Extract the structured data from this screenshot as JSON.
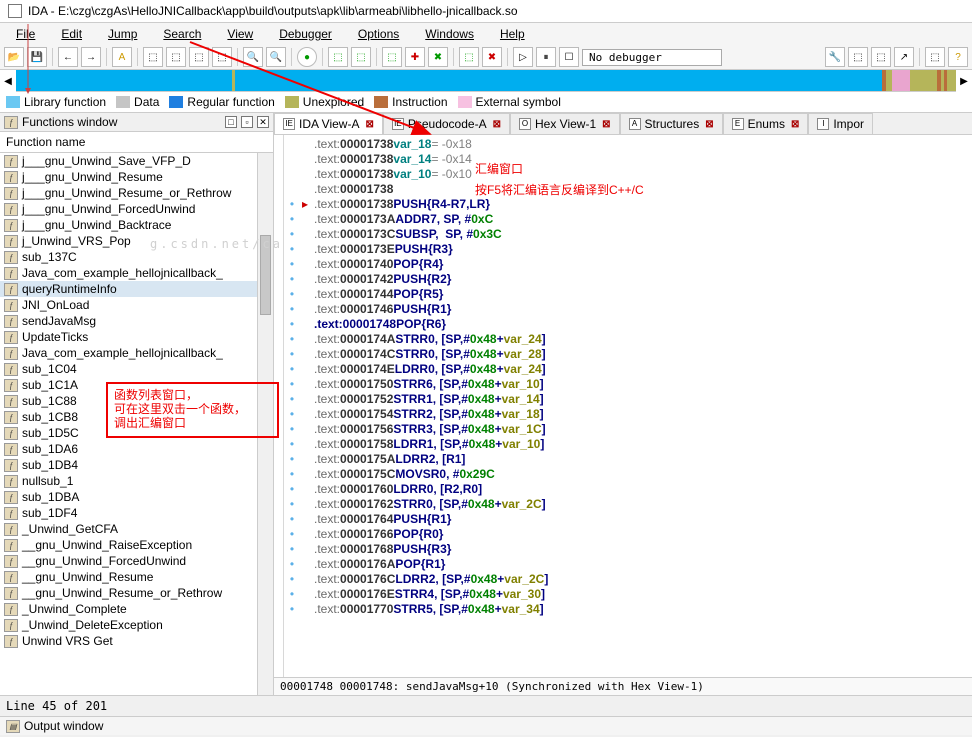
{
  "title": "IDA - E:\\czg\\czgAs\\HelloJNICallback\\app\\build\\outputs\\apk\\lib\\armeabi\\libhello-jnicallback.so",
  "menu": [
    "File",
    "Edit",
    "Jump",
    "Search",
    "View",
    "Debugger",
    "Options",
    "Windows",
    "Help"
  ],
  "debugger_sel": "No debugger",
  "legend": [
    {
      "color": "#6bc8f2",
      "label": "Library function"
    },
    {
      "color": "#c5c5c5",
      "label": "Data"
    },
    {
      "color": "#1f7fe0",
      "label": "Regular function"
    },
    {
      "color": "#b5b55a",
      "label": "Unexplored"
    },
    {
      "color": "#b96e3b",
      "label": "Instruction"
    },
    {
      "color": "#f7c1e1",
      "label": "External symbol"
    }
  ],
  "functions_panel": {
    "title": "Functions window",
    "header": "Function name",
    "items": [
      "j___gnu_Unwind_Save_VFP_D",
      "j___gnu_Unwind_Resume",
      "j___gnu_Unwind_Resume_or_Rethrow",
      "j___gnu_Unwind_ForcedUnwind",
      "j___gnu_Unwind_Backtrace",
      "j_Unwind_VRS_Pop",
      "sub_137C",
      "Java_com_example_hellojnicallback_",
      "queryRuntimeInfo",
      "JNI_OnLoad",
      "sendJavaMsg",
      "UpdateTicks",
      "Java_com_example_hellojnicallback_",
      "sub_1C04",
      "sub_1C1A",
      "sub_1C88",
      "sub_1CB8",
      "sub_1D5C",
      "sub_1DA6",
      "sub_1DB4",
      "nullsub_1",
      "sub_1DBA",
      "sub_1DF4",
      "_Unwind_GetCFA",
      "__gnu_Unwind_RaiseException",
      "__gnu_Unwind_ForcedUnwind",
      "__gnu_Unwind_Resume",
      "__gnu_Unwind_Resume_or_Rethrow",
      "_Unwind_Complete",
      "_Unwind_DeleteException",
      "Unwind VRS Get"
    ],
    "selected_index": 8
  },
  "tabs": [
    {
      "icon": "IE",
      "label": "IDA View-A",
      "active": true,
      "close": true
    },
    {
      "icon": "IE",
      "label": "Pseudocode-A",
      "close": true
    },
    {
      "icon": "O",
      "label": "Hex View-1",
      "close": true
    },
    {
      "icon": "A",
      "label": "Structures",
      "close": true
    },
    {
      "icon": "E",
      "label": "Enums",
      "close": true
    },
    {
      "icon": "I",
      "label": "Impor",
      "close": false
    }
  ],
  "disasm": [
    {
      "b": "",
      "addr": ".text:00001738",
      "lbl": "var_18",
      "eq": "= -0x18"
    },
    {
      "b": "",
      "addr": ".text:00001738",
      "lbl": "var_14",
      "eq": "= -0x14"
    },
    {
      "b": "",
      "addr": ".text:00001738",
      "lbl": "var_10",
      "eq": "= -0x10"
    },
    {
      "b": "",
      "addr": ".text:00001738"
    },
    {
      "b": "•",
      "mark": "▸",
      "addr": ".text:00001738",
      "mn": "PUSH",
      "ops": "{R4-R7,LR}"
    },
    {
      "b": "•",
      "addr": ".text:0000173A",
      "mn": "ADD",
      "ops": "R7, SP, #0xC",
      "hl": "0xC"
    },
    {
      "b": "•",
      "addr": ".text:0000173C",
      "mn": "SUB",
      "ops": "SP,  SP, #0x3C",
      "hl": "0x3C"
    },
    {
      "b": "•",
      "addr": ".text:0000173E",
      "mn": "PUSH",
      "ops": "{R3}"
    },
    {
      "b": "•",
      "addr": ".text:00001740",
      "mn": "POP",
      "ops": "{R4}"
    },
    {
      "b": "•",
      "addr": ".text:00001742",
      "mn": "PUSH",
      "ops": "{R2}"
    },
    {
      "b": "•",
      "addr": ".text:00001744",
      "mn": "POP",
      "ops": "{R5}"
    },
    {
      "b": "•",
      "addr": ".text:00001746",
      "mn": "PUSH",
      "ops": "{R1}"
    },
    {
      "b": "•",
      "addr": ".text:00001748",
      "bold": true,
      "mn": "POP",
      "ops": "{R6}"
    },
    {
      "b": "•",
      "addr": ".text:0000174A",
      "mn": "STR",
      "ops": "R0, [SP,#0x48+var_24]",
      "vr": "var_24"
    },
    {
      "b": "•",
      "addr": ".text:0000174C",
      "mn": "STR",
      "ops": "R0, [SP,#0x48+var_28]",
      "vr": "var_28"
    },
    {
      "b": "•",
      "addr": ".text:0000174E",
      "mn": "LDR",
      "ops": "R0, [SP,#0x48+var_24]",
      "vr": "var_24"
    },
    {
      "b": "•",
      "addr": ".text:00001750",
      "mn": "STR",
      "ops": "R6, [SP,#0x48+var_10]",
      "vr": "var_10"
    },
    {
      "b": "•",
      "addr": ".text:00001752",
      "mn": "STR",
      "ops": "R1, [SP,#0x48+var_14]",
      "vr": "var_14"
    },
    {
      "b": "•",
      "addr": ".text:00001754",
      "mn": "STR",
      "ops": "R2, [SP,#0x48+var_18]",
      "vr": "var_18"
    },
    {
      "b": "•",
      "addr": ".text:00001756",
      "mn": "STR",
      "ops": "R3, [SP,#0x48+var_1C]",
      "vr": "var_1C"
    },
    {
      "b": "•",
      "addr": ".text:00001758",
      "mn": "LDR",
      "ops": "R1, [SP,#0x48+var_10]",
      "vr": "var_10"
    },
    {
      "b": "•",
      "addr": ".text:0000175A",
      "mn": "LDR",
      "ops": "R2, [R1]"
    },
    {
      "b": "•",
      "addr": ".text:0000175C",
      "mn": "MOVS",
      "ops": "R0, #0x29C",
      "hl": "0x29C"
    },
    {
      "b": "•",
      "addr": ".text:00001760",
      "mn": "LDR",
      "ops": "R0, [R2,R0]"
    },
    {
      "b": "•",
      "addr": ".text:00001762",
      "mn": "STR",
      "ops": "R0, [SP,#0x48+var_2C]",
      "vr": "var_2C"
    },
    {
      "b": "•",
      "addr": ".text:00001764",
      "mn": "PUSH",
      "ops": "{R1}"
    },
    {
      "b": "•",
      "addr": ".text:00001766",
      "mn": "POP",
      "ops": "{R0}"
    },
    {
      "b": "•",
      "addr": ".text:00001768",
      "mn": "PUSH",
      "ops": "{R3}"
    },
    {
      "b": "•",
      "addr": ".text:0000176A",
      "mn": "POP",
      "ops": "{R1}"
    },
    {
      "b": "•",
      "addr": ".text:0000176C",
      "mn": "LDR",
      "ops": "R2, [SP,#0x48+var_2C]",
      "vr": "var_2C"
    },
    {
      "b": "•",
      "addr": ".text:0000176E",
      "mn": "STR",
      "ops": "R4, [SP,#0x48+var_30]",
      "vr": "var_30"
    },
    {
      "b": "•",
      "addr": ".text:00001770",
      "mn": "STR",
      "ops": "R5, [SP,#0x48+var_34]",
      "vr": "var_34"
    }
  ],
  "status_line": "00001748 00001748: sendJavaMsg+10 (Synchronized with Hex View-1)",
  "footer": "Line 45 of 201",
  "output_label": "Output window",
  "annotations": {
    "funcbox": "函数列表窗口，\n可在这里双击一个函数，\n调出汇编窗口",
    "asm_title": "汇编窗口",
    "asm_desc": "按F5将汇编语言反编译到C++/C"
  },
  "watermark": "g.csdn.net/ca"
}
